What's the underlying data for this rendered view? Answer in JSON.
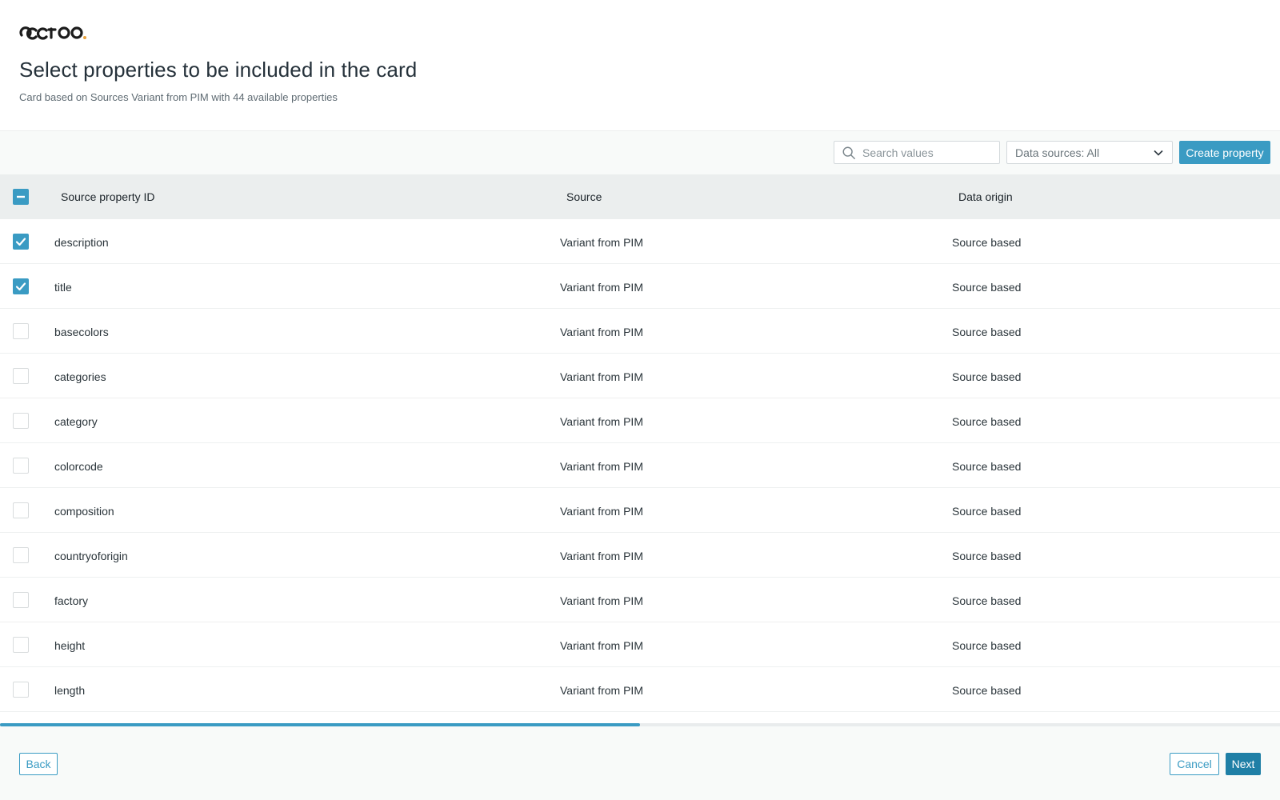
{
  "brand": {
    "logo_text": "occtoo.",
    "accent": "#e8a13b"
  },
  "header": {
    "title": "Select properties to be included in the card",
    "subtitle": "Card based on Sources Variant from PIM with 44 available properties"
  },
  "toolbar": {
    "search_placeholder": "Search values",
    "data_sources_label": "Data sources: All",
    "create_label": "Create property"
  },
  "table": {
    "columns": [
      "Source property ID",
      "Source",
      "Data origin"
    ],
    "select_all_state": "indeterminate",
    "rows": [
      {
        "id": "description",
        "source": "Variant from PIM",
        "origin": "Source based",
        "checked": true
      },
      {
        "id": "title",
        "source": "Variant from PIM",
        "origin": "Source based",
        "checked": true
      },
      {
        "id": "basecolors",
        "source": "Variant from PIM",
        "origin": "Source based",
        "checked": false
      },
      {
        "id": "categories",
        "source": "Variant from PIM",
        "origin": "Source based",
        "checked": false
      },
      {
        "id": "category",
        "source": "Variant from PIM",
        "origin": "Source based",
        "checked": false
      },
      {
        "id": "colorcode",
        "source": "Variant from PIM",
        "origin": "Source based",
        "checked": false
      },
      {
        "id": "composition",
        "source": "Variant from PIM",
        "origin": "Source based",
        "checked": false
      },
      {
        "id": "countryoforigin",
        "source": "Variant from PIM",
        "origin": "Source based",
        "checked": false
      },
      {
        "id": "factory",
        "source": "Variant from PIM",
        "origin": "Source based",
        "checked": false
      },
      {
        "id": "height",
        "source": "Variant from PIM",
        "origin": "Source based",
        "checked": false
      },
      {
        "id": "length",
        "source": "Variant from PIM",
        "origin": "Source based",
        "checked": false
      }
    ]
  },
  "scroll": {
    "thumb_fraction": 0.5
  },
  "footer": {
    "back_label": "Back",
    "cancel_label": "Cancel",
    "next_label": "Next"
  },
  "colors": {
    "primary": "#3a9bc3",
    "primary_dark": "#1f7fa6"
  }
}
